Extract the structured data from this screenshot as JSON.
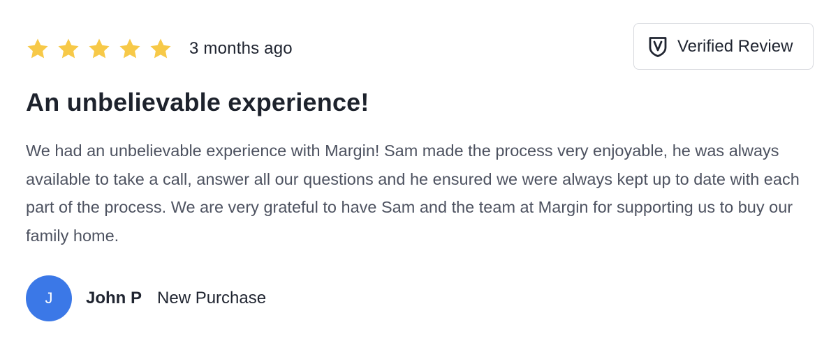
{
  "review": {
    "rating": 5,
    "rating_max": 5,
    "timestamp": "3 months ago",
    "verified_label": "Verified Review",
    "title": "An unbelievable experience!",
    "body": "We had an unbelievable experience with Margin! Sam made the process very enjoyable, he was always available to take a call, answer all our questions and he ensured we were always kept up to date with each part of the process. We are very grateful to have Sam and the team at Margin for supporting us to buy our family home.",
    "author": {
      "initial": "J",
      "name": "John P",
      "type": "New Purchase"
    }
  },
  "icons": {
    "star": "star-icon",
    "verified": "shield-check-icon"
  },
  "colors": {
    "star": "#f7c948",
    "avatar": "#3b78e7",
    "heading": "#1d222c",
    "body_text": "#4d5260",
    "border": "#d7d9de"
  }
}
